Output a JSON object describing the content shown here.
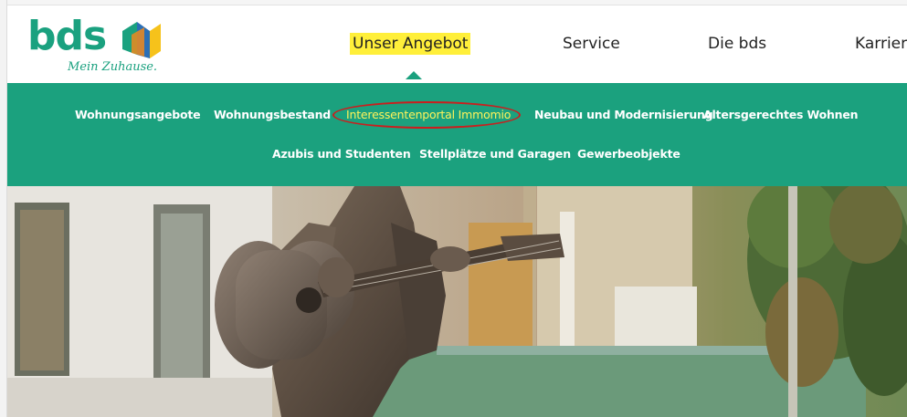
{
  "logo": {
    "text": "bds",
    "slogan": "Mein Zuhause.",
    "colors": {
      "green": "#1aa17f",
      "yellow": "#f6c21b",
      "blue": "#2b6fb6",
      "orange": "#ef8a1d"
    }
  },
  "topnav": [
    {
      "label": "Unser Angebot",
      "active": true
    },
    {
      "label": "Service"
    },
    {
      "label": "Die bds"
    },
    {
      "label": "Karriere"
    }
  ],
  "submenu": {
    "background": "#1ba17e",
    "row1": [
      "Wohnungsangebote",
      "Wohnungsbestand",
      "Interessentenportal Immomio",
      "Neubau und Modernisierung",
      "Altersgerechtes Wohnen"
    ],
    "row2": [
      "Azubis und Studenten",
      "Stellplätze und Garagen",
      "Gewerbeobjekte"
    ],
    "highlighted": "Interessentenportal Immomio",
    "annotation_color": "#cc1d1d"
  },
  "hero": {
    "image": "bronze-statue-guitar-player-photo"
  }
}
